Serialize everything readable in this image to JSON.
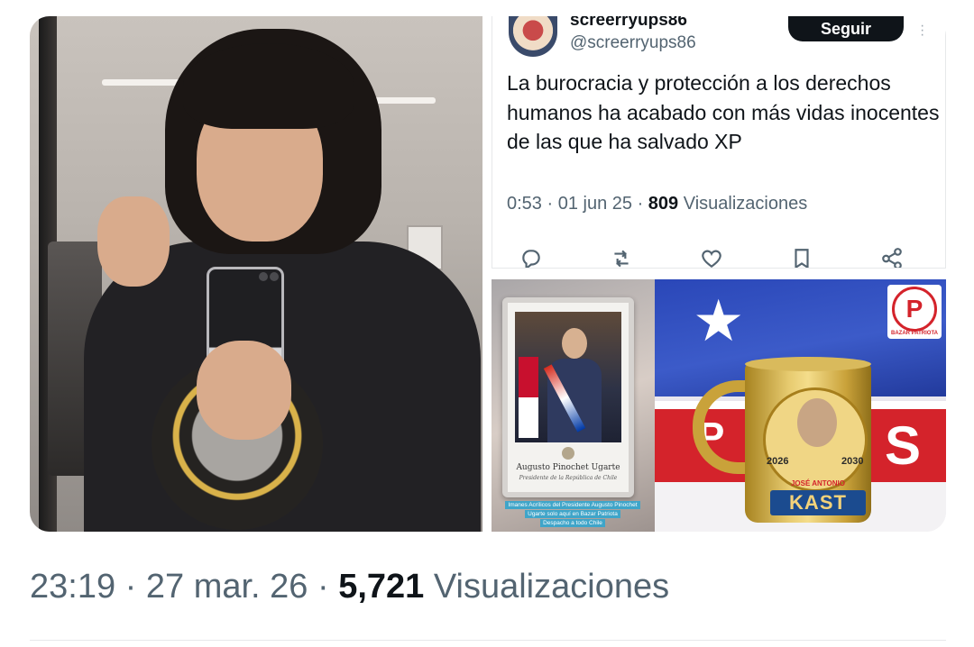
{
  "embedded_tweet": {
    "display_name": "screerryups86",
    "handle": "@screerryups86",
    "follow_label": "Seguir",
    "more_icon": "more-vertical-icon",
    "text": "La burocracia y protección a los derechos humanos ha acabado con más vidas inocentes de las que ha salvado XP",
    "time": "0:53",
    "date": "01 jun 25",
    "views_count": "809",
    "views_label": "Visualizaciones",
    "actions": [
      "reply-icon",
      "retweet-icon",
      "like-icon",
      "bookmark-icon",
      "share-icon"
    ]
  },
  "images": {
    "frame": {
      "plaque_title": "Augusto Pinochet Ugarte",
      "plaque_subtitle": "Presidente de la República de Chile",
      "caption_lines": [
        "Imanes Acrílicos del Presidente Augusto Pinochet",
        "Ugarte solo aquí en Bazar Patriota",
        "Despacho a todo Chile"
      ]
    },
    "mug": {
      "logo_letter": "P",
      "logo_text": "BAZAR PATRIOTA",
      "year_left": "2026",
      "year_right": "2030",
      "banner_top": "JOSÉ ANTONIO",
      "banner_main": "KAST",
      "flag_text_left": "P",
      "flag_text_right": "S"
    }
  },
  "post_meta": {
    "time": "23:19",
    "date": "27 mar. 26",
    "views_count": "5,721",
    "views_label": "Visualizaciones"
  },
  "colors": {
    "text_primary": "#0f1419",
    "text_secondary": "#536471",
    "follow_button_bg": "#0f1419",
    "divider": "#e6e8ea"
  }
}
